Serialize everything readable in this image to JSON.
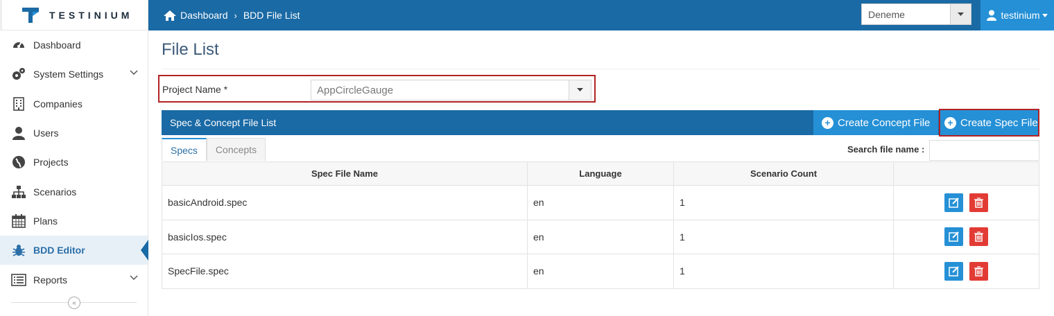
{
  "brand": {
    "name": "TESTINIUM"
  },
  "breadcrumb": {
    "home": "Dashboard",
    "current": "BDD File List"
  },
  "top_select": {
    "value": "Deneme"
  },
  "user": {
    "name": "testinium"
  },
  "sidebar": {
    "items": [
      {
        "label": "Dashboard",
        "icon": "dashboard-icon"
      },
      {
        "label": "System Settings",
        "icon": "gears-icon"
      },
      {
        "label": "Companies",
        "icon": "building-icon"
      },
      {
        "label": "Users",
        "icon": "user-icon"
      },
      {
        "label": "Projects",
        "icon": "globe-icon"
      },
      {
        "label": "Scenarios",
        "icon": "sitemap-icon"
      },
      {
        "label": "Plans",
        "icon": "calendar-icon"
      },
      {
        "label": "BDD Editor",
        "icon": "bug-icon"
      },
      {
        "label": "Reports",
        "icon": "list-icon"
      }
    ]
  },
  "page": {
    "title": "File List"
  },
  "project": {
    "label": "Project Name",
    "required": "*",
    "value": "AppCircleGauge"
  },
  "panel": {
    "title": "Spec & Concept File List",
    "create_concept": "Create Concept File",
    "create_spec": "Create Spec File"
  },
  "tabs": [
    "Specs",
    "Concepts"
  ],
  "search": {
    "label": "Search file name :"
  },
  "table": {
    "headers": [
      "Spec File Name",
      "Language",
      "Scenario Count",
      ""
    ],
    "rows": [
      [
        "basicAndroid.spec",
        "en",
        "1"
      ],
      [
        "basicIos.spec",
        "en",
        "1"
      ],
      [
        "SpecFile.spec",
        "en",
        "1"
      ]
    ]
  },
  "colors": {
    "primary": "#1a6aa5",
    "accent": "#2590d6",
    "danger": "#e23b35",
    "highlight": "#b22222"
  }
}
